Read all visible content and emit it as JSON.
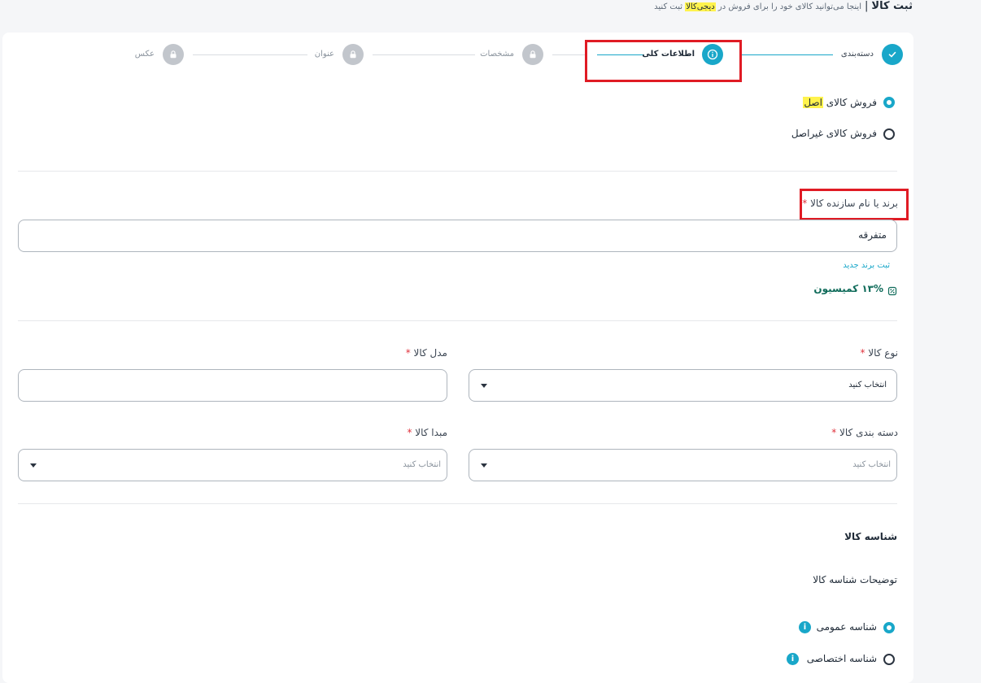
{
  "header": {
    "title": "ثبت کالا",
    "separator": "|",
    "subtitle_before": "اینجا می‌توانید کالای خود را برای فروش در",
    "subtitle_brand": "دیجی‌کالا",
    "subtitle_after": "ثبت کنید"
  },
  "stepper": {
    "steps": [
      {
        "label": "دسته‌بندی",
        "state": "done",
        "icon": "check-icon"
      },
      {
        "label": "اطلاعات کلی",
        "state": "active",
        "icon": "info-icon"
      },
      {
        "label": "مشخصات",
        "state": "locked",
        "icon": "lock-icon"
      },
      {
        "label": "عنوان",
        "state": "locked",
        "icon": "lock-icon"
      },
      {
        "label": "عکس",
        "state": "locked",
        "icon": "lock-icon"
      }
    ]
  },
  "sale_type": {
    "original_prefix": "فروش کالای",
    "original_highlight": "اصل",
    "non_original": "فروش کالای غیراصل",
    "selected": "original"
  },
  "brand": {
    "label": "برند یا نام سازنده کالا",
    "required_mark": "*",
    "value": "متفرقه",
    "new_brand_link": "ثبت برند جدید",
    "commission": "۱۳% کمیسیون"
  },
  "fields": {
    "product_type": {
      "label": "نوع کالا",
      "required_mark": "*",
      "value": "انتخاب کنید"
    },
    "model": {
      "label": "مدل کالا",
      "required_mark": "*",
      "value": ""
    },
    "category": {
      "label": "دسته بندی کالا",
      "required_mark": "*",
      "placeholder": "انتخاب کنید"
    },
    "origin": {
      "label": "مبدا کالا",
      "required_mark": "*",
      "placeholder": "انتخاب کنید"
    }
  },
  "identifier": {
    "section_title": "شناسه کالا",
    "description_title": "توضیحات شناسه کالا",
    "options": [
      {
        "label": "شناسه عمومی",
        "selected": true
      },
      {
        "label": "شناسه اختصاصی",
        "selected": false
      }
    ],
    "info_glyph": "i"
  },
  "colors": {
    "accent": "#19a7c9",
    "highlight": "#fff34d",
    "required": "#e0323c",
    "annotation_box": "#e01b24",
    "commission_text": "#0f6b5a"
  }
}
